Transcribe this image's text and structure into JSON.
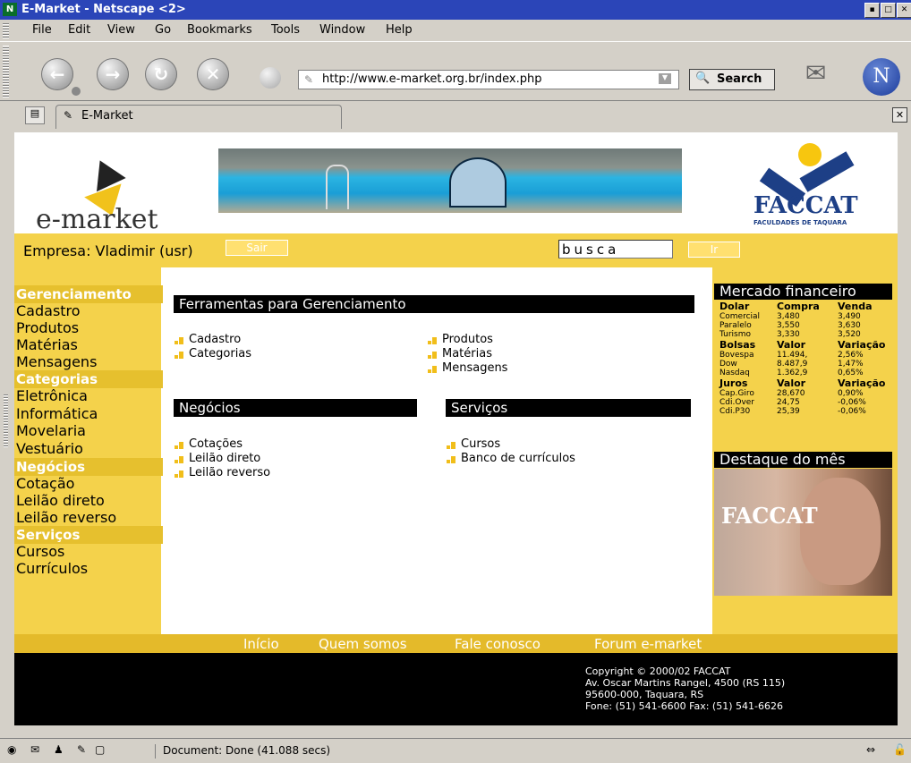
{
  "window": {
    "logo": "N",
    "title": "E-Market - Netscape <2>"
  },
  "menu": [
    "File",
    "Edit",
    "View",
    "Go",
    "Bookmarks",
    "Tools",
    "Window",
    "Help"
  ],
  "nav": {
    "url": "http://www.e-market.org.br/index.php",
    "search_label": "Search",
    "netscape_logo": "N"
  },
  "tab": {
    "title": "E-Market"
  },
  "page": {
    "brand": "e-market",
    "faccat_name": "FACCAT",
    "faccat_sub": "FACULDADES DE TAQUARA",
    "empresa": "Empresa: Vladimir (usr)",
    "sair_label": "Sair",
    "search_value": "busca",
    "go_label": "Ir",
    "sidebar": {
      "cat1": "Gerenciamento",
      "cat1_items": [
        "Cadastro",
        "Produtos",
        "Matérias",
        "Mensagens"
      ],
      "cat2": "Categorias",
      "cat2_items": [
        "Eletrônica",
        "Informática",
        "Movelaria",
        "Vestuário"
      ],
      "cat3": "Negócios",
      "cat3_items": [
        "Cotação",
        "Leilão direto",
        "Leilão reverso"
      ],
      "cat4": "Serviços",
      "cat4_items": [
        "Cursos",
        "Currículos"
      ]
    },
    "sections": {
      "ger_title": "Ferramentas para Gerenciamento",
      "ger_left": [
        "Cadastro",
        "Categorias"
      ],
      "ger_right": [
        "Produtos",
        "Matérias",
        "Mensagens"
      ],
      "neg_title": "Negócios",
      "neg_items": [
        "Cotações",
        "Leilão direto",
        "Leilão reverso"
      ],
      "serv_title": "Serviços",
      "serv_items": [
        "Cursos",
        "Banco de currículos"
      ]
    },
    "mercado": {
      "title": "Mercado financeiro",
      "dolar": {
        "head": [
          "Dolar",
          "Compra",
          "Venda"
        ],
        "rows": [
          [
            "Comercial",
            "3,480",
            "3,490"
          ],
          [
            "Paralelo",
            "3,550",
            "3,630"
          ],
          [
            "Turismo",
            "3,330",
            "3,520"
          ]
        ]
      },
      "bolsas": {
        "head": [
          "Bolsas",
          "Valor",
          "Variação"
        ],
        "rows": [
          [
            "Bovespa",
            "11.494,",
            "2,56%"
          ],
          [
            "Dow",
            "8.487,9",
            "1,47%"
          ],
          [
            "Nasdaq",
            "1.362,9",
            "0,65%"
          ]
        ]
      },
      "juros": {
        "head": [
          "Juros",
          "Valor",
          "Variação"
        ],
        "rows": [
          [
            "Cap.Giro",
            "28,670",
            "0,90%"
          ],
          [
            "Cdi.Over",
            "24,75",
            "-0,06%"
          ],
          [
            "Cdi.P30",
            "25,39",
            "-0,06%"
          ]
        ]
      }
    },
    "destaque": {
      "title": "Destaque do mês",
      "img_text": "FACCAT"
    },
    "footer_links": [
      "Início",
      "Quem somos",
      "Fale conosco",
      "Forum e-market"
    ],
    "copyright": [
      "Copyright © 2000/02 FACCAT",
      "Av. Oscar Martins Rangel, 4500 (RS 115)",
      "95600-000, Taquara, RS",
      "Fone: (51) 541-6600 Fax: (51) 541-6626"
    ]
  },
  "status": {
    "text": "Document: Done (41.088 secs)"
  },
  "colors": {
    "yellow": "#f4d24b",
    "category": "#e6c02e",
    "titlebar": "#2b45b8"
  }
}
